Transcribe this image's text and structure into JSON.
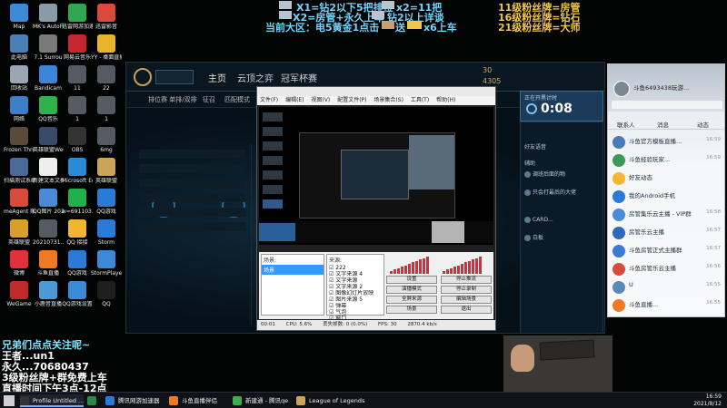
{
  "desktop_icons": [
    {
      "label": "Map",
      "color": "#3b8ad9"
    },
    {
      "label": "MK's AutoFire",
      "color": "#8a9aa8"
    },
    {
      "label": "迅雷网游加速器",
      "color": "#2fa84f"
    },
    {
      "label": "迅雷影音",
      "color": "#d94a3a"
    },
    {
      "label": "此电脑",
      "color": "#4a7fb8"
    },
    {
      "label": "7.1 Surrou",
      "color": "#7a7a7a"
    },
    {
      "label": "网易云音乐",
      "color": "#c8262e"
    },
    {
      "label": "YY - 桌面直播",
      "color": "#e8b52a"
    },
    {
      "label": "回收站",
      "color": "#9aa6b2"
    },
    {
      "label": "Bandicam",
      "color": "#3a86d8"
    },
    {
      "label": "11",
      "color": "#555b62"
    },
    {
      "label": "22",
      "color": "#555b62"
    },
    {
      "label": "网络",
      "color": "#3a7fc8"
    },
    {
      "label": "QQ音乐",
      "color": "#2fb24a"
    },
    {
      "label": "1",
      "color": "#555b62"
    },
    {
      "label": "1",
      "color": "#555b62"
    },
    {
      "label": "Frozen Throne",
      "color": "#5a4a3a"
    },
    {
      "label": "英雄联盟WeGame 0.6.24",
      "color": "#3a4a6a"
    },
    {
      "label": "OBS",
      "color": "#333"
    },
    {
      "label": "6mg",
      "color": "#555b62"
    },
    {
      "label": "扫描测试系统",
      "color": "#4a6a9a"
    },
    {
      "label": "新建文本文档",
      "color": "#eeeeee"
    },
    {
      "label": "Microsoft Edge",
      "color": "#2a8ad8"
    },
    {
      "label": "英雄联盟",
      "color": "#c9a45a"
    },
    {
      "label": "meAgent 账户",
      "color": "#d84a3a"
    },
    {
      "label": "QQ图片 20210...",
      "color": "#4a8ad8"
    },
    {
      "label": "w=691103...",
      "color": "#22b04a"
    },
    {
      "label": "QQ游戏",
      "color": "#2a7ad8"
    },
    {
      "label": "英雄联盟",
      "color": "#d8a02a"
    },
    {
      "label": "20210731...",
      "color": "#555b62"
    },
    {
      "label": "QQ 接接",
      "color": "#f2b431"
    },
    {
      "label": "Storm",
      "color": "#2a7ad8"
    },
    {
      "label": "微博",
      "color": "#e0303a"
    },
    {
      "label": "斗鱼直播",
      "color": "#f07a22"
    },
    {
      "label": "QQ游戏",
      "color": "#2a7ad8"
    },
    {
      "label": "StormPlayer",
      "color": "#3a8ad8"
    },
    {
      "label": "WeGame",
      "color": "#c02a2a"
    },
    {
      "label": "小鹿音直播",
      "color": "#4a9ad8"
    },
    {
      "label": "QQ游戏设置",
      "color": "#3a8ad8"
    },
    {
      "label": "QQ",
      "color": "#1f1f1f"
    }
  ],
  "overlay": {
    "top_line1_a": "X1=钻2以下5把排位",
    "top_line1_b": "x2=11把",
    "top_line2_a": "X2=房管+永久上车",
    "top_line2_b": "钻2以上详谈",
    "top_line3": "当前大区：电5黄金1点击",
    "top_line3_b": "送",
    "top_line3_c": "x6上车",
    "right_line1": "11级粉丝牌=房管",
    "right_line2": "16级粉丝牌=钻石",
    "right_line3": "21级粉丝牌=大师",
    "left_line1": "兄弟们点点关注呢~",
    "left_line2": "王者...un1",
    "left_line3": "永久...70680437",
    "left_line4": "3级粉丝牌+群免费上车",
    "left_line5": "直播时间下午3点-12点"
  },
  "lol": {
    "nav": [
      "主页",
      "云顶之弈",
      "冠军杯赛"
    ],
    "sub": [
      "排位赛 单排/双排",
      "征召",
      "匹配模式"
    ],
    "status": "30",
    "status2": "4305"
  },
  "obs": {
    "menu": [
      "文件(F)",
      "编辑(E)",
      "视图(V)",
      "配置文件(P)",
      "场景集合(S)",
      "工具(T)",
      "帮助(H)"
    ],
    "scenes_header": "场景:",
    "scenes": [
      "场景"
    ],
    "sources_header": "来源:",
    "sources": [
      "222",
      "文字来源 4",
      "文字来源",
      "文字来源 2",
      "图像幻灯片放映",
      "图片来源 5",
      "弹幕",
      "气泡",
      "窗口"
    ],
    "buttons": [
      "设置",
      "停止推流",
      "演播模式",
      "停止录制",
      "全屏来源",
      "编辑场景",
      "场景",
      "退出"
    ],
    "status": [
      "00:01",
      "CPU: 5.6%",
      "丢失帧数: 0 (0.0%)",
      "FPS: 30",
      "2870.4 kb/s"
    ]
  },
  "timer": {
    "caption": "正在开黑计时",
    "time": "0:08"
  },
  "voice": [
    "好友语音",
    "辅助",
    "调班后面的物",
    "只会打最后的大佬",
    "CARD...",
    "白板"
  ],
  "qq": {
    "name": "斗鱼6493438玩游...",
    "tabs": [
      "联系人",
      "消息",
      "动态"
    ],
    "rows": [
      {
        "name": "斗鱼官方模板直播...",
        "sub": "",
        "time": "16:59",
        "color": "#4a7ab8"
      },
      {
        "name": "斗鱼经验玩家...",
        "sub": "",
        "time": "16:59",
        "color": "#3a9a5a"
      },
      {
        "name": "好友动态",
        "sub": "",
        "time": "",
        "color": "#f5b431"
      },
      {
        "name": "我的Android手机",
        "sub": "",
        "time": "",
        "color": "#2a7ad8"
      },
      {
        "name": "房管集乐云主播 - VIP群",
        "sub": "",
        "time": "16:58",
        "color": "#4a8ad8"
      },
      {
        "name": "房管乐云主播",
        "sub": "",
        "time": "16:57",
        "color": "#2a6ab8"
      },
      {
        "name": "斗鱼房管正式主播群",
        "sub": "",
        "time": "16:57",
        "color": "#3a7ad8"
      },
      {
        "name": "斗鱼房管乐云主播",
        "sub": "",
        "time": "16:56",
        "color": "#d84a3a"
      },
      {
        "name": "U",
        "sub": "",
        "time": "16:55",
        "color": "#5a8ab8"
      },
      {
        "name": "斗鱼直播...",
        "sub": "",
        "time": "16:55",
        "color": "#f07a22"
      }
    ]
  },
  "taskbar": {
    "items": [
      {
        "label": "Profile Untitled ...",
        "color": "#333",
        "active": true
      },
      {
        "label": "",
        "color": "#2a8a4a",
        "active": false
      },
      {
        "label": "腾讯网游加速器",
        "color": "#2a7ad8",
        "active": false
      },
      {
        "label": "斗鱼直播伴侣",
        "color": "#f07a22",
        "active": false
      },
      {
        "label": "腾讯会议",
        "color": "#4a8ad8",
        "active": false
      },
      {
        "label": "新建通 - 腾讯qe",
        "color": "#3ab04a",
        "active": false
      },
      {
        "label": "League of Legends",
        "color": "#c9a45a",
        "active": false
      }
    ],
    "time": "16:59",
    "date": "2021/8/12"
  }
}
